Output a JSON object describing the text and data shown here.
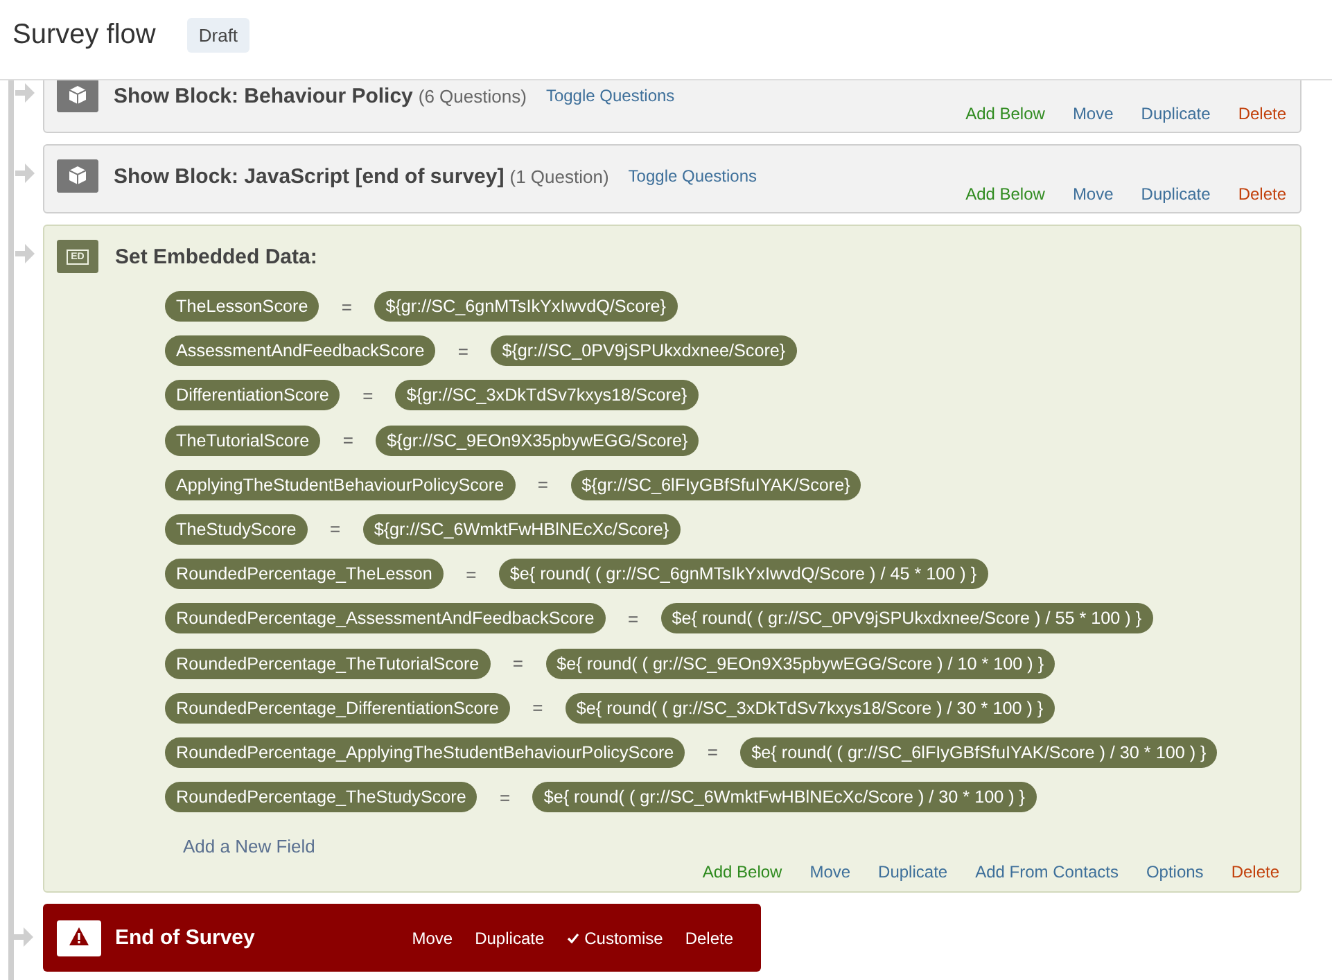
{
  "header": {
    "title": "Survey flow",
    "badge": "Draft"
  },
  "flow": [
    {
      "kind": "block",
      "title": "Show Block: Behaviour Policy",
      "count": "(6 Questions)",
      "toggle": "Toggle Questions",
      "actions": [
        {
          "label": "Add Below",
          "kind": "add"
        },
        {
          "label": "Move",
          "kind": "plain"
        },
        {
          "label": "Duplicate",
          "kind": "plain"
        },
        {
          "label": "Delete",
          "kind": "delete"
        }
      ]
    },
    {
      "kind": "block",
      "title": "Show Block: JavaScript [end of survey]",
      "count": "(1 Question)",
      "toggle": "Toggle Questions",
      "actions": [
        {
          "label": "Add Below",
          "kind": "add"
        },
        {
          "label": "Move",
          "kind": "plain"
        },
        {
          "label": "Duplicate",
          "kind": "plain"
        },
        {
          "label": "Delete",
          "kind": "delete"
        }
      ]
    },
    {
      "kind": "embedded",
      "icon": "ED",
      "title": "Set Embedded Data:",
      "fields": [
        {
          "name": "TheLessonScore",
          "op": "=",
          "value": "${gr://SC_6gnMTsIkYxIwvdQ/Score}"
        },
        {
          "name": "AssessmentAndFeedbackScore",
          "op": "=",
          "value": "${gr://SC_0PV9jSPUkxdxnee/Score}"
        },
        {
          "name": "DifferentiationScore",
          "op": "=",
          "value": "${gr://SC_3xDkTdSv7kxys18/Score}"
        },
        {
          "name": "TheTutorialScore",
          "op": "=",
          "value": "${gr://SC_9EOn9X35pbywEGG/Score}"
        },
        {
          "name": "ApplyingTheStudentBehaviourPolicyScore",
          "op": "=",
          "value": "${gr://SC_6lFIyGBfSfuIYAK/Score}"
        },
        {
          "name": "TheStudyScore",
          "op": "=",
          "value": "${gr://SC_6WmktFwHBlNEcXc/Score}"
        },
        {
          "name": "RoundedPercentage_TheLesson",
          "op": "=",
          "value": "$e{ round( ( gr://SC_6gnMTsIkYxIwvdQ/Score ) / 45 * 100 ) }"
        },
        {
          "name": "RoundedPercentage_AssessmentAndFeedbackScore",
          "op": "=",
          "value": "$e{ round( ( gr://SC_0PV9jSPUkxdxnee/Score ) / 55 * 100 ) }"
        },
        {
          "name": "RoundedPercentage_TheTutorialScore",
          "op": "=",
          "value": "$e{ round( ( gr://SC_9EOn9X35pbywEGG/Score ) / 10 * 100 ) }"
        },
        {
          "name": "RoundedPercentage_DifferentiationScore",
          "op": "=",
          "value": "$e{ round( ( gr://SC_3xDkTdSv7kxys18/Score ) / 30 * 100 ) }"
        },
        {
          "name": "RoundedPercentage_ApplyingTheStudentBehaviourPolicyScore",
          "op": "=",
          "value": "$e{ round( ( gr://SC_6lFIyGBfSfuIYAK/Score ) / 30 * 100 ) }"
        },
        {
          "name": "RoundedPercentage_TheStudyScore",
          "op": "=",
          "value": "$e{ round( ( gr://SC_6WmktFwHBlNEcXc/Score ) / 30 * 100 ) }"
        }
      ],
      "add_field": "Add a New Field",
      "actions": [
        {
          "label": "Add Below",
          "kind": "add"
        },
        {
          "label": "Move",
          "kind": "plain"
        },
        {
          "label": "Duplicate",
          "kind": "plain"
        },
        {
          "label": "Add From Contacts",
          "kind": "plain"
        },
        {
          "label": "Options",
          "kind": "plain"
        },
        {
          "label": "Delete",
          "kind": "delete"
        }
      ]
    },
    {
      "kind": "end",
      "title": "End of Survey",
      "actions": [
        {
          "label": "Move",
          "kind": "plain"
        },
        {
          "label": "Duplicate",
          "kind": "plain"
        },
        {
          "label": "Customise",
          "kind": "check",
          "checked": true
        },
        {
          "label": "Delete",
          "kind": "plain"
        }
      ]
    }
  ]
}
